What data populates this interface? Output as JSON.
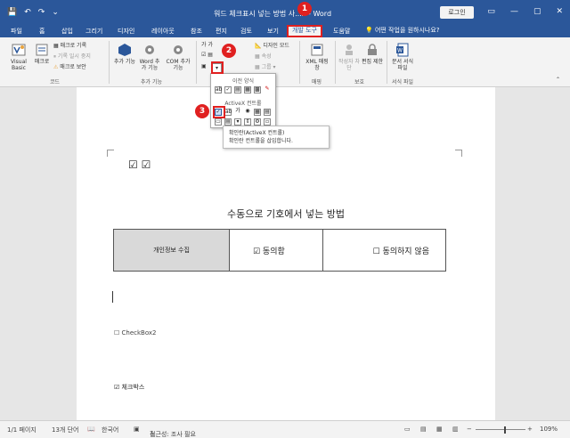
{
  "titlebar": {
    "save_icon": "save-icon",
    "undo_icon": "undo-icon",
    "redo_icon": "redo-icon",
    "title": "워드 체크표시 넣는 방법 사...x - Word",
    "login": "로그인",
    "minimize": "—",
    "restore": "▢",
    "close": "✕"
  },
  "tabs": [
    {
      "label": "파일"
    },
    {
      "label": "홈"
    },
    {
      "label": "삽입"
    },
    {
      "label": "그리기"
    },
    {
      "label": "디자인"
    },
    {
      "label": "레이아웃"
    },
    {
      "label": "참조"
    },
    {
      "label": "편지"
    },
    {
      "label": "검토"
    },
    {
      "label": "보기"
    },
    {
      "label": "개발 도구"
    },
    {
      "label": "도움말"
    }
  ],
  "tellme": "어떤 작업을 원하시나요?",
  "ribbon": {
    "visual_basic": "Visual Basic",
    "macro": "매크로",
    "record_macro": "매크로 기록",
    "pause_record": "기록 일시 중지",
    "macro_security": "매크로 보안",
    "group_code": "코드",
    "addins": "추가 기능",
    "word_addins": "Word 추가 기능",
    "com_addins": "COM 추가 기능",
    "group_addins": "추가 기능",
    "design_mode": "디자인 모드",
    "properties": "속성",
    "group_btn": "그룹",
    "xml_mapping": "XML 매핑 창",
    "group_mapping": "매핑",
    "block_authors": "작성자 차단",
    "restrict_editing": "편집 제한",
    "group_protect": "보호",
    "doc_template": "문서 서식 파일",
    "group_template": "서식 파일"
  },
  "dropdown": {
    "legacy_header": "이전 양식",
    "activex_header": "ActiveX 컨트롤"
  },
  "tooltip": {
    "title": "확인란(ActiveX 컨트롤)",
    "desc": "확인란 컨트롤을 삽입합니다."
  },
  "callouts": {
    "one": "1",
    "two": "2",
    "three": "3"
  },
  "document": {
    "checks_top": "☑ ☑",
    "heading": "수동으로 기호에서 넣는 방법",
    "table_label": "개인정보 수집",
    "agree": "☑ 동의함",
    "disagree": "☐ 동의하지 않음",
    "checkbox2": "☐ CheckBox2",
    "checkbox_kr": "☑ 체크박스"
  },
  "status": {
    "page": "1/1 페이지",
    "words": "13개 단어",
    "lang": "한국어",
    "accessibility": "접근성: 조사 필요",
    "zoom": "109%"
  }
}
